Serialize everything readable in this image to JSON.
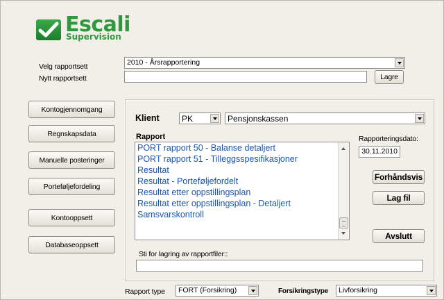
{
  "brand": {
    "title": "Escali",
    "subtitle": "Supervision",
    "color": "#2e9a3e"
  },
  "form": {
    "velg_label": "Velg rapportsett",
    "velg_value": "2010 - Årsrapportering",
    "nytt_label": "Nytt rapportsett",
    "nytt_value": "",
    "lagre_label": "Lagre"
  },
  "sidebar": {
    "items": [
      {
        "label": "Kontogjennomgang"
      },
      {
        "label": "Regnskapsdata"
      },
      {
        "label": "Manuelle posteringer"
      },
      {
        "label": "Porteføljefordeling"
      },
      {
        "label": "Kontooppsett"
      },
      {
        "label": "Databaseoppsett"
      }
    ]
  },
  "panel": {
    "klient_label": "Klient",
    "klient_code": "PK",
    "klient_name": "Pensjonskassen",
    "rapport_label": "Rapport",
    "reports": [
      "PORT rapport 50 - Balanse detaljert",
      "PORT rapport 51 - Tilleggsspesifikasjoner",
      "Resultat",
      "Resultat - Porteføljefordelt",
      "Resultat etter oppstillingsplan",
      "Resultat etter oppstillingsplan - Detaljert",
      "Samsvarskontroll"
    ],
    "dato_label": "Rapporteringsdato:",
    "dato_value": "30.11.2010",
    "forhandsvis_label": "Forhåndsvis",
    "lag_fil_label": "Lag fil",
    "avslutt_label": "Avslutt",
    "sti_label": "Sti for lagring av rapportfiler::",
    "sti_value": ""
  },
  "footer": {
    "rapport_type_label": "Rapport type",
    "rapport_type_value": "FORT (Forsikring)",
    "forsikringstype_label": "Forsikringstype",
    "forsikringstype_value": "Livforsikring"
  },
  "colors": {
    "background": "#f1efe8",
    "list_text": "#1a55b0"
  }
}
